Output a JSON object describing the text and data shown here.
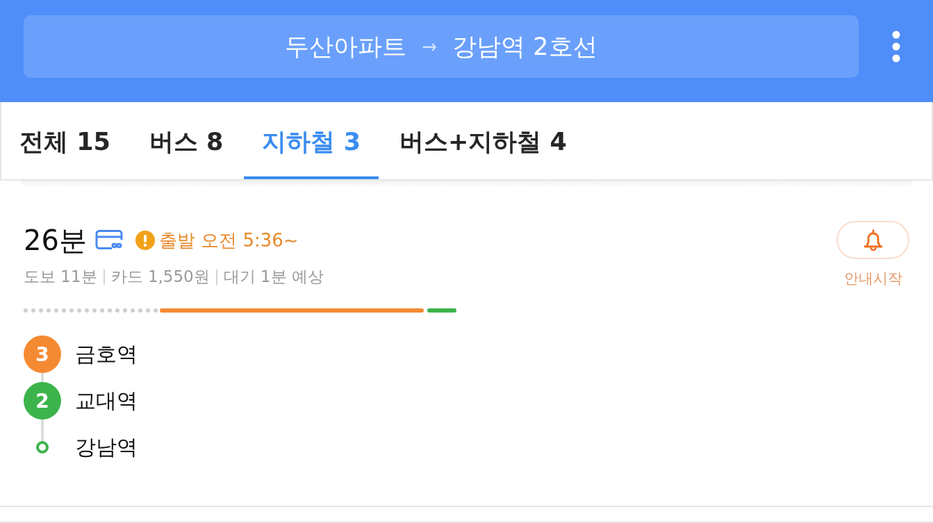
{
  "header": {
    "origin": "두산아파트",
    "arrow": "→",
    "destination": "강남역 2호선"
  },
  "tabs": [
    {
      "label": "전체 15",
      "selected": false
    },
    {
      "label": "버스 8",
      "selected": false
    },
    {
      "label": "지하철 3",
      "selected": true
    },
    {
      "label": "버스+지하철 4",
      "selected": false
    }
  ],
  "route": {
    "duration": "26분",
    "departure": "출발 오전 5:36~",
    "details": [
      "도보 11분",
      "카드 1,550원",
      "대기 1분 예상"
    ],
    "alert": {
      "label": "안내시작"
    },
    "stops": [
      {
        "kind": "line",
        "badge": "3",
        "name": "금호역",
        "color": "#f58a33"
      },
      {
        "kind": "line",
        "badge": "2",
        "name": "교대역",
        "color": "#3cb44b"
      },
      {
        "kind": "end",
        "name": "강남역",
        "color": "#3cb44b"
      }
    ]
  }
}
